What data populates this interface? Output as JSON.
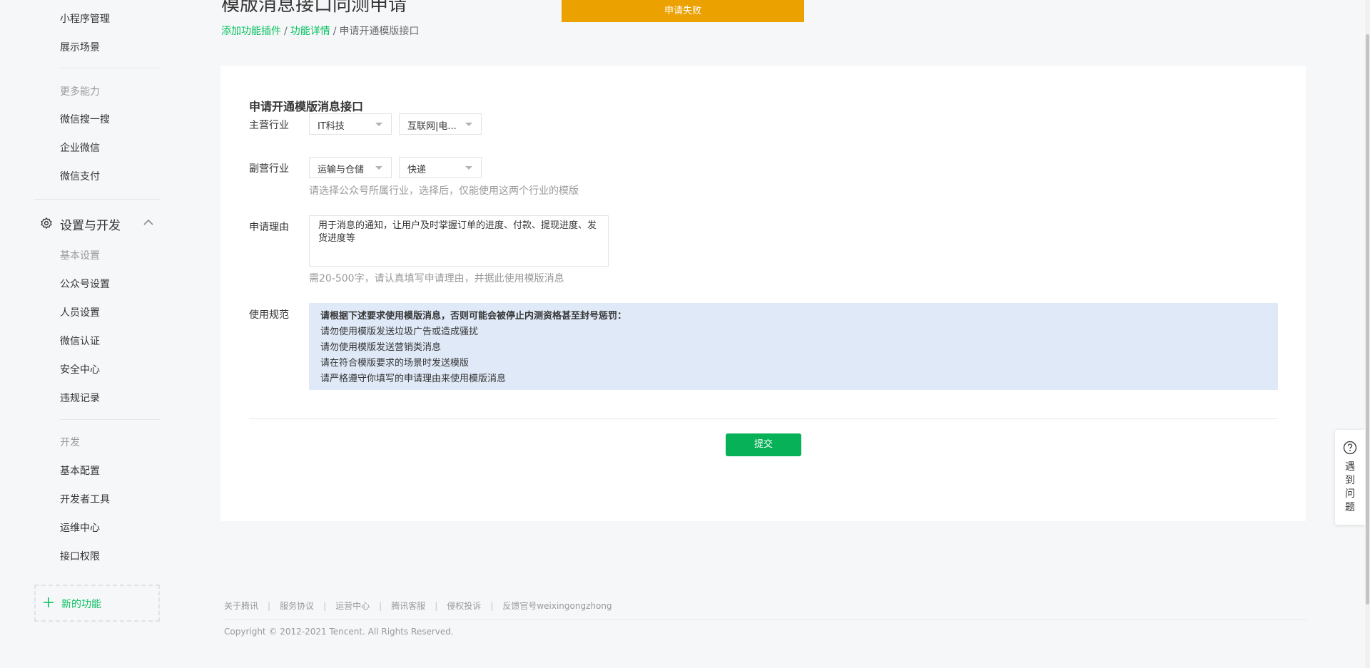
{
  "sidebar": {
    "top_items": [
      {
        "label": "小程序管理"
      },
      {
        "label": "展示场景"
      }
    ],
    "more_group": "更多能力",
    "more_items": [
      {
        "label": "微信搜一搜"
      },
      {
        "label": "企业微信"
      },
      {
        "label": "微信支付"
      }
    ],
    "settings_section": "设置与开发",
    "basic_group": "基本设置",
    "basic_items": [
      {
        "label": "公众号设置"
      },
      {
        "label": "人员设置"
      },
      {
        "label": "微信认证"
      },
      {
        "label": "安全中心"
      },
      {
        "label": "违规记录"
      }
    ],
    "dev_group": "开发",
    "dev_items": [
      {
        "label": "基本配置"
      },
      {
        "label": "开发者工具"
      },
      {
        "label": "运维中心"
      },
      {
        "label": "接口权限"
      }
    ],
    "new_feature": "新的功能"
  },
  "header": {
    "title": "模版消息接口同测申请",
    "breadcrumb": [
      "添加功能插件",
      "功能详情",
      "申请开通模版接口"
    ],
    "breadcrumb_sep": "/"
  },
  "toast": "申请失败",
  "form": {
    "title": "申请开通模版消息接口",
    "main_industry_label": "主营行业",
    "main_industry": [
      "IT科技",
      "互联网|电..."
    ],
    "sub_industry_label": "副营行业",
    "sub_industry": [
      "运输与仓储",
      "快递"
    ],
    "industry_hint": "请选择公众号所属行业，选择后，仅能使用这两个行业的模版",
    "reason_label": "申请理由",
    "reason_value": "用于消息的通知，让用户及时掌握订单的进度、付款、提现进度、发货进度等",
    "reason_hint": "需20-500字，请认真填写申请理由，并据此使用模版消息",
    "rules_label": "使用规范",
    "rules": [
      "请根据下述要求使用模版消息，否则可能会被停止内测资格甚至封号惩罚：",
      "请勿使用模版发送垃圾广告或造成骚扰",
      "请勿使用模版发送营销类消息",
      "请在符合模版要求的场景时发送模版",
      "请严格遵守你填写的申请理由来使用模版消息"
    ],
    "submit": "提交"
  },
  "footer": {
    "links": [
      "关于腾讯",
      "服务协议",
      "运营中心",
      "腾讯客服",
      "侵权投诉",
      "反馈官号weixingongzhong"
    ],
    "separator": "|",
    "copyright": "Copyright © 2012-2021 Tencent. All Rights Reserved."
  },
  "help": {
    "label": "遇到问题"
  },
  "colors": {
    "accent": "#07c160",
    "toast": "#eba100",
    "rules_bg": "#dfe9f7",
    "submit": "#07b158"
  }
}
